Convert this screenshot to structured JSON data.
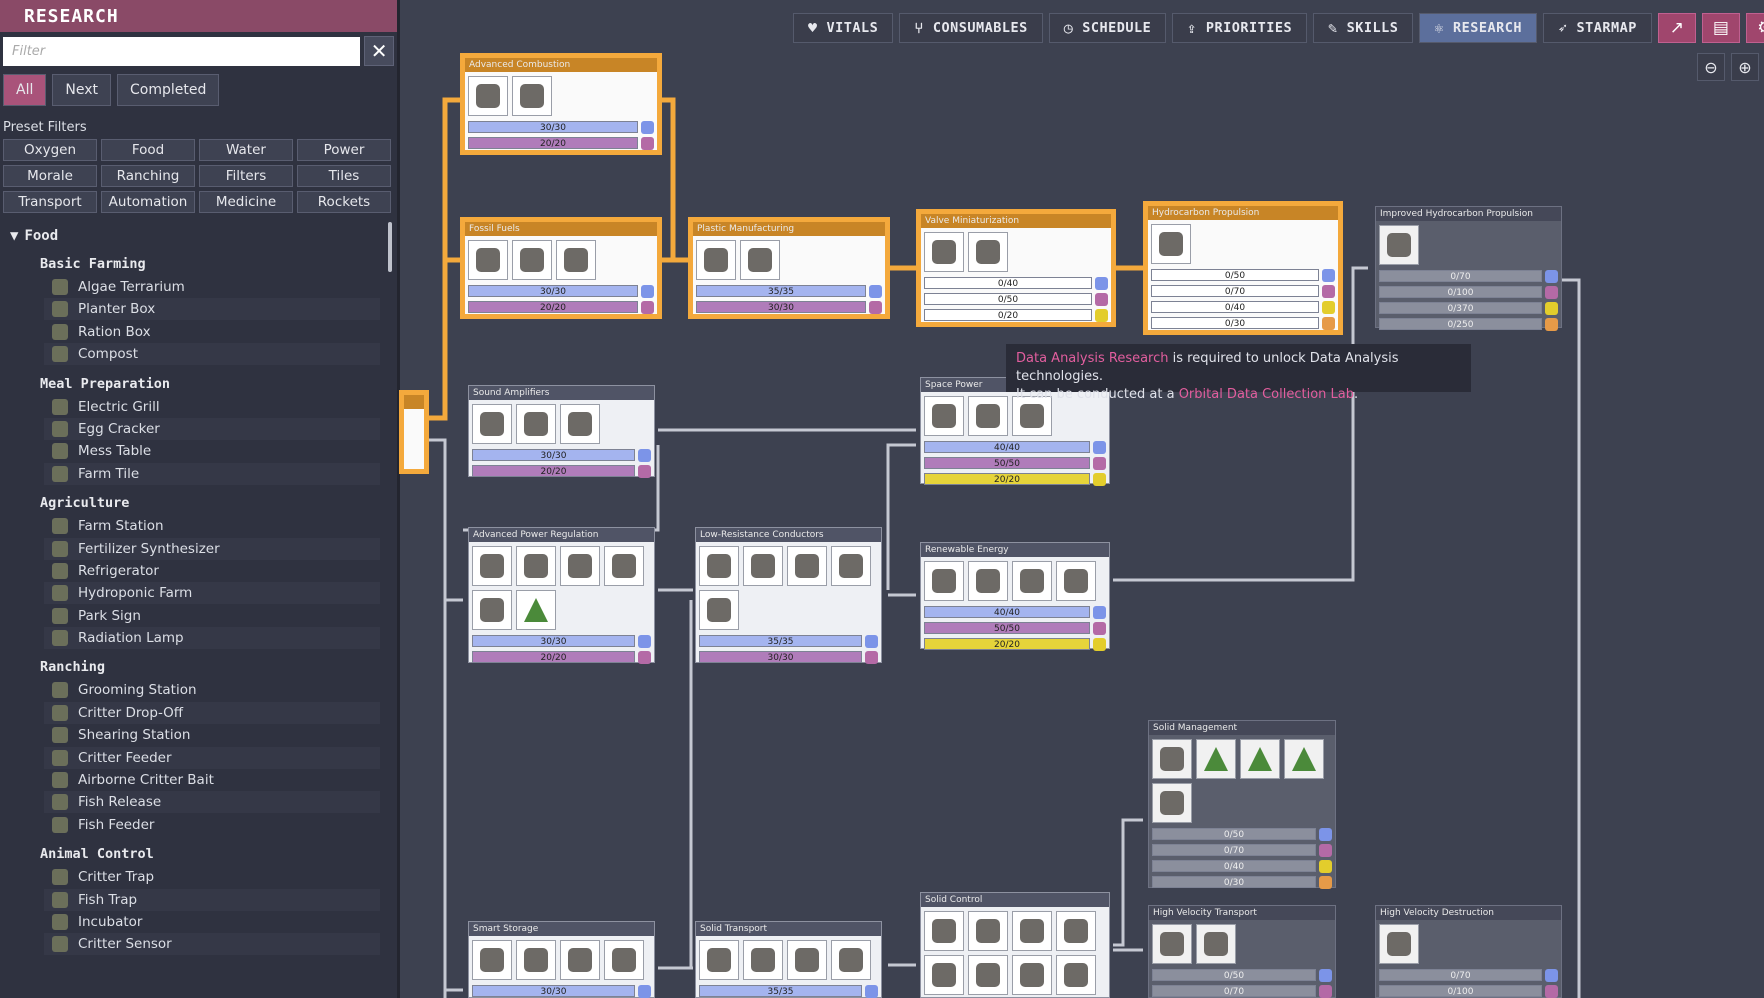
{
  "panel": {
    "title": "RESEARCH",
    "filter_placeholder": "Filter",
    "tabs": [
      "All",
      "Next",
      "Completed"
    ],
    "preset_label": "Preset Filters",
    "presets": [
      "Oxygen",
      "Food",
      "Water",
      "Power",
      "Morale",
      "Ranching",
      "Filters",
      "Tiles",
      "Transport",
      "Automation",
      "Medicine",
      "Rockets"
    ],
    "category": "Food",
    "groups": [
      {
        "name": "Basic Farming",
        "items": [
          "Algae Terrarium",
          "Planter Box",
          "Ration Box",
          "Compost"
        ]
      },
      {
        "name": "Meal Preparation",
        "items": [
          "Electric Grill",
          "Egg Cracker",
          "Mess Table",
          "Farm Tile"
        ]
      },
      {
        "name": "Agriculture",
        "items": [
          "Farm Station",
          "Fertilizer Synthesizer",
          "Refrigerator",
          "Hydroponic Farm",
          "Park Sign",
          "Radiation Lamp"
        ]
      },
      {
        "name": "Ranching",
        "items": [
          "Grooming Station",
          "Critter Drop-Off",
          "Shearing Station",
          "Critter Feeder",
          "Airborne Critter Bait",
          "Fish Release",
          "Fish Feeder"
        ]
      },
      {
        "name": "Animal Control",
        "items": [
          "Critter Trap",
          "Fish Trap",
          "Incubator",
          "Critter Sensor"
        ]
      }
    ]
  },
  "nav": {
    "buttons": [
      {
        "label": "VITALS",
        "icon": "heart-icon",
        "glyph": "♥"
      },
      {
        "label": "CONSUMABLES",
        "icon": "cutlery-icon",
        "glyph": "⑂"
      },
      {
        "label": "SCHEDULE",
        "icon": "clock-icon",
        "glyph": "◷"
      },
      {
        "label": "PRIORITIES",
        "icon": "priority-arrow-icon",
        "glyph": "⇪"
      },
      {
        "label": "SKILLS",
        "icon": "wrench-icon",
        "glyph": "✎"
      },
      {
        "label": "RESEARCH",
        "icon": "atom-icon",
        "glyph": "⚛"
      },
      {
        "label": "STARMAP",
        "icon": "rocket-icon",
        "glyph": "➶"
      }
    ]
  },
  "tooltip": {
    "line1_link": "Data Analysis Research",
    "line1_rest": " is required to unlock Data Analysis technologies.",
    "line2_pre": "It can be conducted at a ",
    "line2_link": "Orbital Data Collection Lab",
    "line2_post": "."
  },
  "techs": {
    "advanced_combustion": {
      "title": "Advanced Combustion",
      "bars": [
        "30/30",
        "20/20"
      ]
    },
    "fossil_fuels": {
      "title": "Fossil Fuels",
      "bars": [
        "30/30",
        "20/20"
      ]
    },
    "plastic_manufacturing": {
      "title": "Plastic Manufacturing",
      "bars": [
        "35/35",
        "30/30"
      ]
    },
    "valve_miniaturization": {
      "title": "Valve Miniaturization",
      "bars": [
        "0/40",
        "0/50",
        "0/20"
      ]
    },
    "hydrocarbon_propulsion": {
      "title": "Hydrocarbon Propulsion",
      "bars": [
        "0/50",
        "0/70",
        "0/40",
        "0/30"
      ]
    },
    "improved_hydrocarbon_propulsion": {
      "title": "Improved Hydrocarbon Propulsion",
      "bars": [
        "0/70",
        "0/100",
        "0/370",
        "0/250"
      ]
    },
    "sound_amplifiers": {
      "title": "Sound Amplifiers",
      "bars": [
        "30/30",
        "20/20"
      ]
    },
    "space_power": {
      "title": "Space Power",
      "bars": [
        "40/40",
        "50/50",
        "20/20"
      ]
    },
    "advanced_power_regulation": {
      "title": "Advanced Power Regulation",
      "bars": [
        "30/30",
        "20/20"
      ]
    },
    "low_resistance_conductors": {
      "title": "Low-Resistance Conductors",
      "bars": [
        "35/35",
        "30/30"
      ]
    },
    "renewable_energy": {
      "title": "Renewable Energy",
      "bars": [
        "40/40",
        "50/50",
        "20/20"
      ]
    },
    "solid_management": {
      "title": "Solid Management",
      "bars": [
        "0/50",
        "0/70",
        "0/40",
        "0/30"
      ]
    },
    "smart_storage": {
      "title": "Smart Storage",
      "bars": [
        "30/30"
      ]
    },
    "solid_transport": {
      "title": "Solid Transport",
      "bars": [
        "35/35"
      ]
    },
    "solid_control": {
      "title": "Solid Control",
      "bars": []
    },
    "high_velocity_transport": {
      "title": "High Velocity Transport",
      "bars": [
        "0/50",
        "0/70"
      ]
    },
    "high_velocity_destruction": {
      "title": "High Velocity Destruction",
      "bars": [
        "0/70",
        "0/100"
      ]
    }
  }
}
